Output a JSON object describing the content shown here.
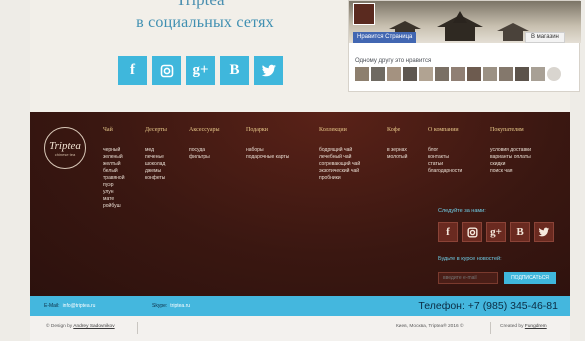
{
  "brand": {
    "name": "Triptea"
  },
  "social": {
    "title": "в социальных сетях",
    "icons": [
      {
        "name": "facebook",
        "label": "f"
      },
      {
        "name": "instagram",
        "label": ""
      },
      {
        "name": "google-plus",
        "label": "g+"
      },
      {
        "name": "vkontakte",
        "label": "B"
      },
      {
        "name": "twitter",
        "label": ""
      }
    ]
  },
  "facebook_widget": {
    "like_button": "Нравится Страница",
    "shop_button": "В магазин",
    "friends_text": "Одному другу это нравится"
  },
  "footer": {
    "logo_text": "Triptea",
    "logo_sub": "chinese tea",
    "columns": [
      {
        "heading": "Чай",
        "items": [
          "черный",
          "зеленый",
          "желтый",
          "белый",
          "травяной",
          "пуэр",
          "улун",
          "мате",
          "ройбуш"
        ]
      },
      {
        "heading": "Десерты",
        "items": [
          "мед",
          "печенье",
          "шоколад",
          "джемы",
          "конфеты"
        ]
      },
      {
        "heading": "Аксессуары",
        "items": [
          "посуда",
          "фильтры"
        ]
      },
      {
        "heading": "Подарки",
        "items": [
          "наборы",
          "подарочные карты"
        ]
      },
      {
        "heading": "Коллекции",
        "items": [
          "бодрящий чай",
          "лечебный чай",
          "согревающий чай",
          "экзотический чай",
          "пробники"
        ]
      },
      {
        "heading": "Кофе",
        "items": [
          "в зернах",
          "молотый"
        ]
      },
      {
        "heading": "О компании",
        "items": [
          "блог",
          "контакты",
          "статьи",
          "благодарности"
        ]
      },
      {
        "heading": "Покупателям",
        "items": [
          "условия доставки",
          "варианты оплаты",
          "скидки",
          "поиск чая"
        ]
      }
    ],
    "follow_text": "Следуйте за нами:",
    "follow_icons": [
      "f",
      "",
      "g+",
      "B",
      ""
    ],
    "newsletter_text": "Будьте в курсе новостей:",
    "email_placeholder": "введите e-mail",
    "subscribe_label": "ПОДПИСАТЬСЯ"
  },
  "contact_bar": {
    "email_label": "E-Mail:",
    "email_value": "info@triptea.ru",
    "skype_label": "Skype:",
    "skype_value": "triptea.ru",
    "phone": "Телефон: +7 (985) 345-46-81"
  },
  "bottom_bar": {
    "design_prefix": "© Design by",
    "designer": "Andrey Sadovnikov",
    "city_copyright": "Киев, Москва, Triptea® 2016 ©",
    "created_prefix": "Created by",
    "creator": "Fungdrem"
  },
  "colors": {
    "accent": "#3fb7dc",
    "footer_bg": "#3a1711",
    "heading_gold": "#e8c98a"
  }
}
